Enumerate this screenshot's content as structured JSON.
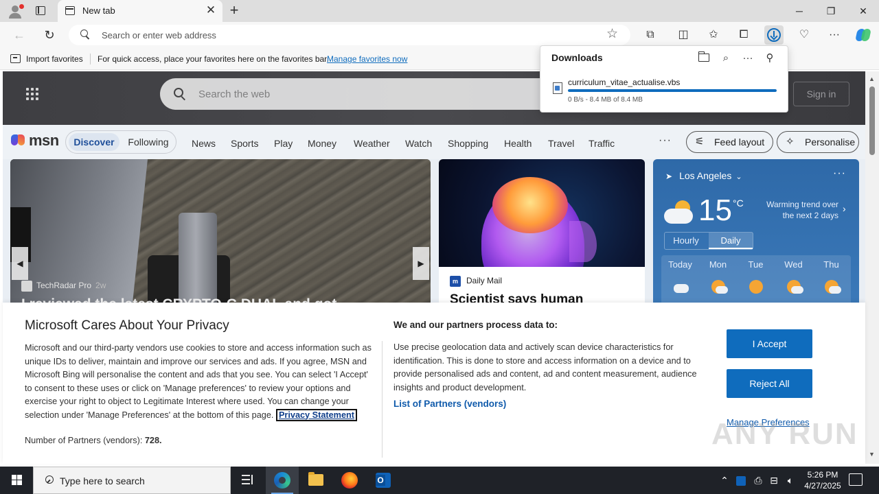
{
  "browser": {
    "tab_title": "New tab",
    "address_placeholder": "Search or enter web address"
  },
  "favorites_bar": {
    "import_label": "Import favorites",
    "message": "For quick access, place your favorites here on the favorites bar.",
    "manage_link": "Manage favorites now"
  },
  "downloads": {
    "title": "Downloads",
    "item": {
      "filename": "curriculum_vitae_actualise.vbs",
      "status": "0 B/s - 8.4 MB of 8.4 MB",
      "progress_percent": 100
    }
  },
  "msn": {
    "search_placeholder": "Search the web",
    "sign_in": "Sign in",
    "logo_text": "msn",
    "segments": [
      "Discover",
      "Following"
    ],
    "nav": [
      "News",
      "Sports",
      "Play",
      "Money",
      "Weather",
      "Watch",
      "Shopping",
      "Health",
      "Travel",
      "Traffic"
    ],
    "more": "···",
    "feed_layout": "Feed layout",
    "personalise": "Personalise",
    "card1": {
      "source": "TechRadar Pro",
      "age": "2w",
      "headline": "I reviewed the latest CRYPTO-C DUAL and got"
    },
    "card2": {
      "source_logo": "m",
      "source": "Daily Mail",
      "headline": "Scientist says human"
    },
    "weather": {
      "location": "Los Angeles",
      "temperature": "15",
      "unit": "°C",
      "trend": "Warming trend over the next 2 days",
      "tabs": [
        "Hourly",
        "Daily"
      ],
      "days": [
        "Today",
        "Mon",
        "Tue",
        "Wed",
        "Thu"
      ]
    }
  },
  "privacy": {
    "title": "Microsoft Cares About Your Privacy",
    "body": "Microsoft and our third-party vendors use cookies to store and access information such as unique IDs to deliver, maintain and improve our services and ads. If you agree, MSN and Microsoft Bing will personalise the content and ads that you see. You can select 'I Accept' to consent to these uses or click on 'Manage preferences' to review your options and exercise your right to object to Legitimate Interest where used. You can change your selection under 'Manage Preferences' at the bottom of this page.",
    "privacy_link": "Privacy Statement",
    "partners_label": "Number of Partners (vendors):",
    "partners_count": "728.",
    "process_heading": "We and our partners process data to:",
    "process_body": "Use precise geolocation data and actively scan device characteristics for identification. This is done to store and access information on a device and to provide personalised ads and content, ad and content measurement, audience insights and product development.",
    "list_partners": "List of Partners (vendors)",
    "accept": "I Accept",
    "reject": "Reject All",
    "manage": "Manage Preferences"
  },
  "watermark": "ANY RUN",
  "taskbar": {
    "search_placeholder": "Type here to search",
    "time": "5:26 PM",
    "date": "4/27/2025"
  },
  "colors": {
    "accent": "#0f6cbd",
    "taskbar": "#1f2228"
  }
}
